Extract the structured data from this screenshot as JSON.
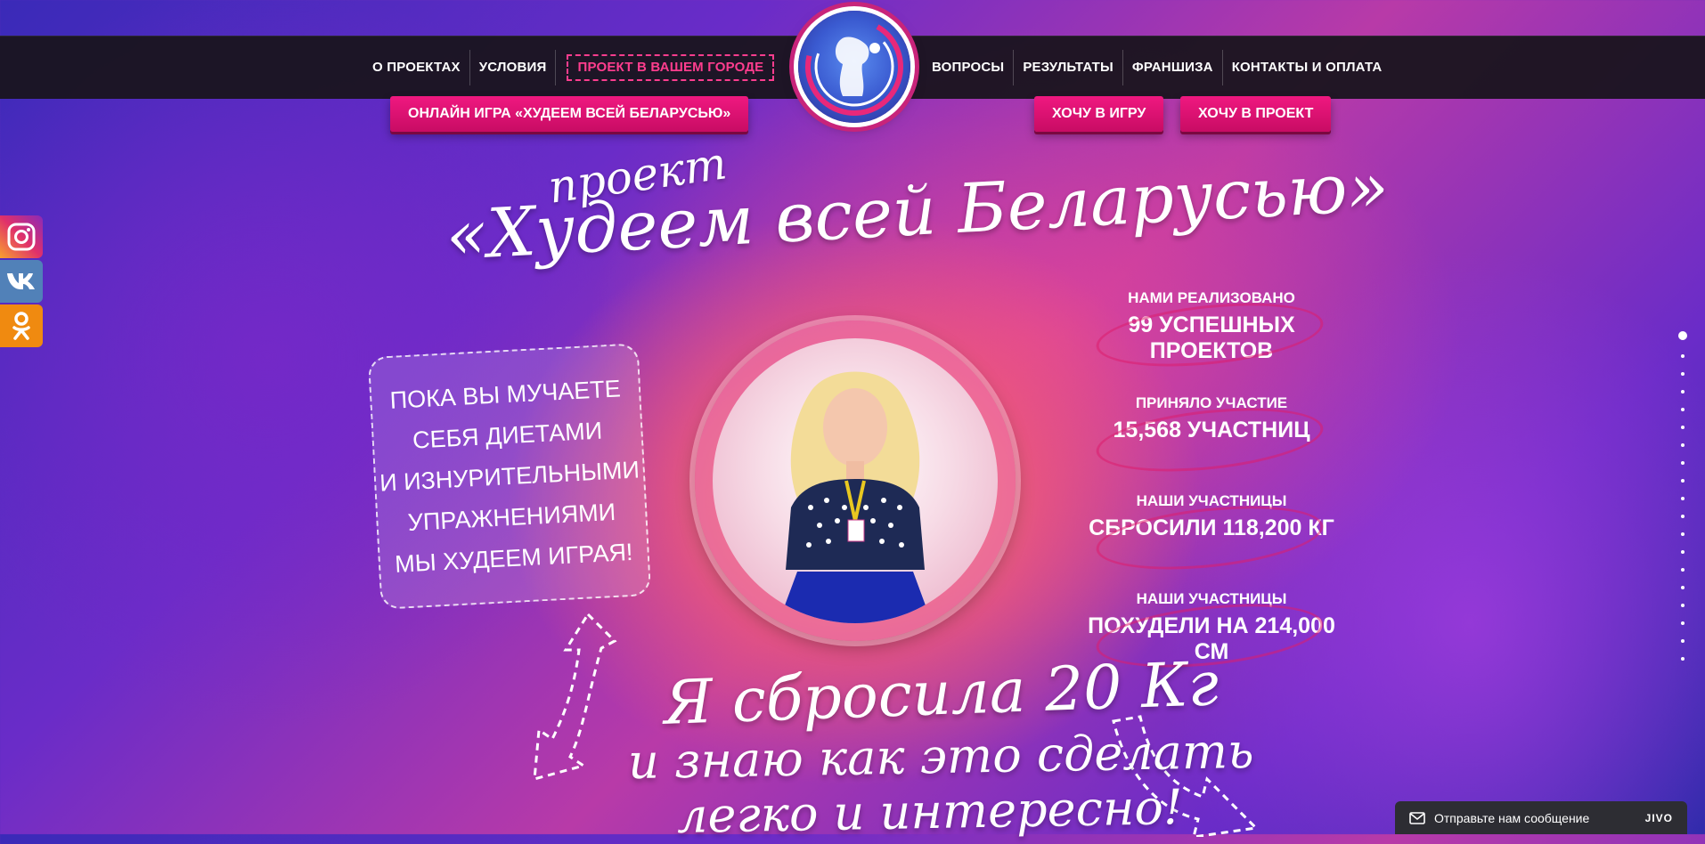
{
  "nav": {
    "left": [
      "О ПРОЕКТАХ",
      "УСЛОВИЯ",
      "ПРОЕКТ В ВАШЕМ ГОРОДЕ"
    ],
    "right": [
      "ВОПРОСЫ",
      "РЕЗУЛЬТАТЫ",
      "ФРАНШИЗА",
      "КОНТАКТЫ И ОПЛАТА"
    ]
  },
  "buttons": {
    "online_game": "ОНЛАЙН ИГРА «ХУДЕЕМ ВСЕЙ БЕЛАРУСЬЮ»",
    "want_game": "ХОЧУ В ИГРУ",
    "want_project": "ХОЧУ В ПРОЕКТ"
  },
  "hero": {
    "title_small": "проект",
    "title_big": "«Худеем всей Беларусью»",
    "quote": [
      "ПОКА ВЫ МУЧАЕТЕ",
      "СЕБЯ ДИЕТАМИ",
      "И ИЗНУРИТЕЛЬНЫМИ",
      "УПРАЖНЕНИЯМИ",
      "МЫ ХУДЕЕМ ИГРАЯ!"
    ],
    "claim_line1": "Я сбросила 20 Кг",
    "claim_line2": "и знаю как это сделать",
    "claim_line3": "легко и интересно!"
  },
  "stats": [
    {
      "label": "НАМИ РЕАЛИЗОВАНО",
      "value": "99 УСПЕШНЫХ ПРОЕКТОВ"
    },
    {
      "label": "ПРИНЯЛО УЧАСТИЕ",
      "value": "15,568 УЧАСТНИЦ"
    },
    {
      "label": "НАШИ УЧАСТНИЦЫ",
      "value": "СБРОСИЛИ 118,200 КГ"
    },
    {
      "label": "НАШИ УЧАСТНИЦЫ",
      "value": "ПОХУДЕЛИ НА 214,000 СМ"
    }
  ],
  "chat": {
    "text": "Отправьте нам сообщение",
    "brand": "JIVO"
  },
  "social": {
    "instagram": "instagram-icon",
    "vk": "vk-icon",
    "ok": "ok-icon"
  },
  "colors": {
    "accent": "#f01880",
    "topbar": "#19141e"
  }
}
